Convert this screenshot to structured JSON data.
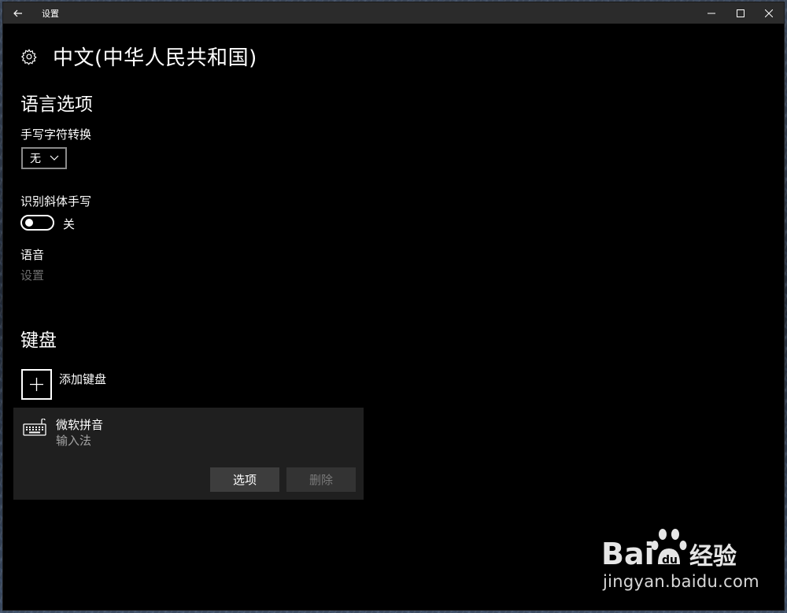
{
  "window": {
    "title": "设置"
  },
  "page": {
    "title": "中文(中华人民共和国)"
  },
  "language_options": {
    "heading": "语言选项",
    "handwriting_conversion": {
      "label": "手写字符转换",
      "selected": "无"
    },
    "italic_handwriting": {
      "label": "识别斜体手写",
      "state": "关",
      "on": false
    },
    "speech": {
      "label": "语音",
      "link": "设置"
    }
  },
  "keyboard": {
    "heading": "键盘",
    "add_label": "添加键盘",
    "items": [
      {
        "name": "微软拼音",
        "subtitle": "输入法",
        "options_label": "选项",
        "remove_label": "删除"
      }
    ]
  },
  "watermark": {
    "brand_left": "Bai",
    "brand_right": "经验",
    "url": "jingyan.baidu.com"
  },
  "colors": {
    "window_bg": "#000000",
    "titlebar_bg": "#2b2b2b",
    "card_bg": "#1f1f1f",
    "disabled_text": "#6d6d6d"
  }
}
